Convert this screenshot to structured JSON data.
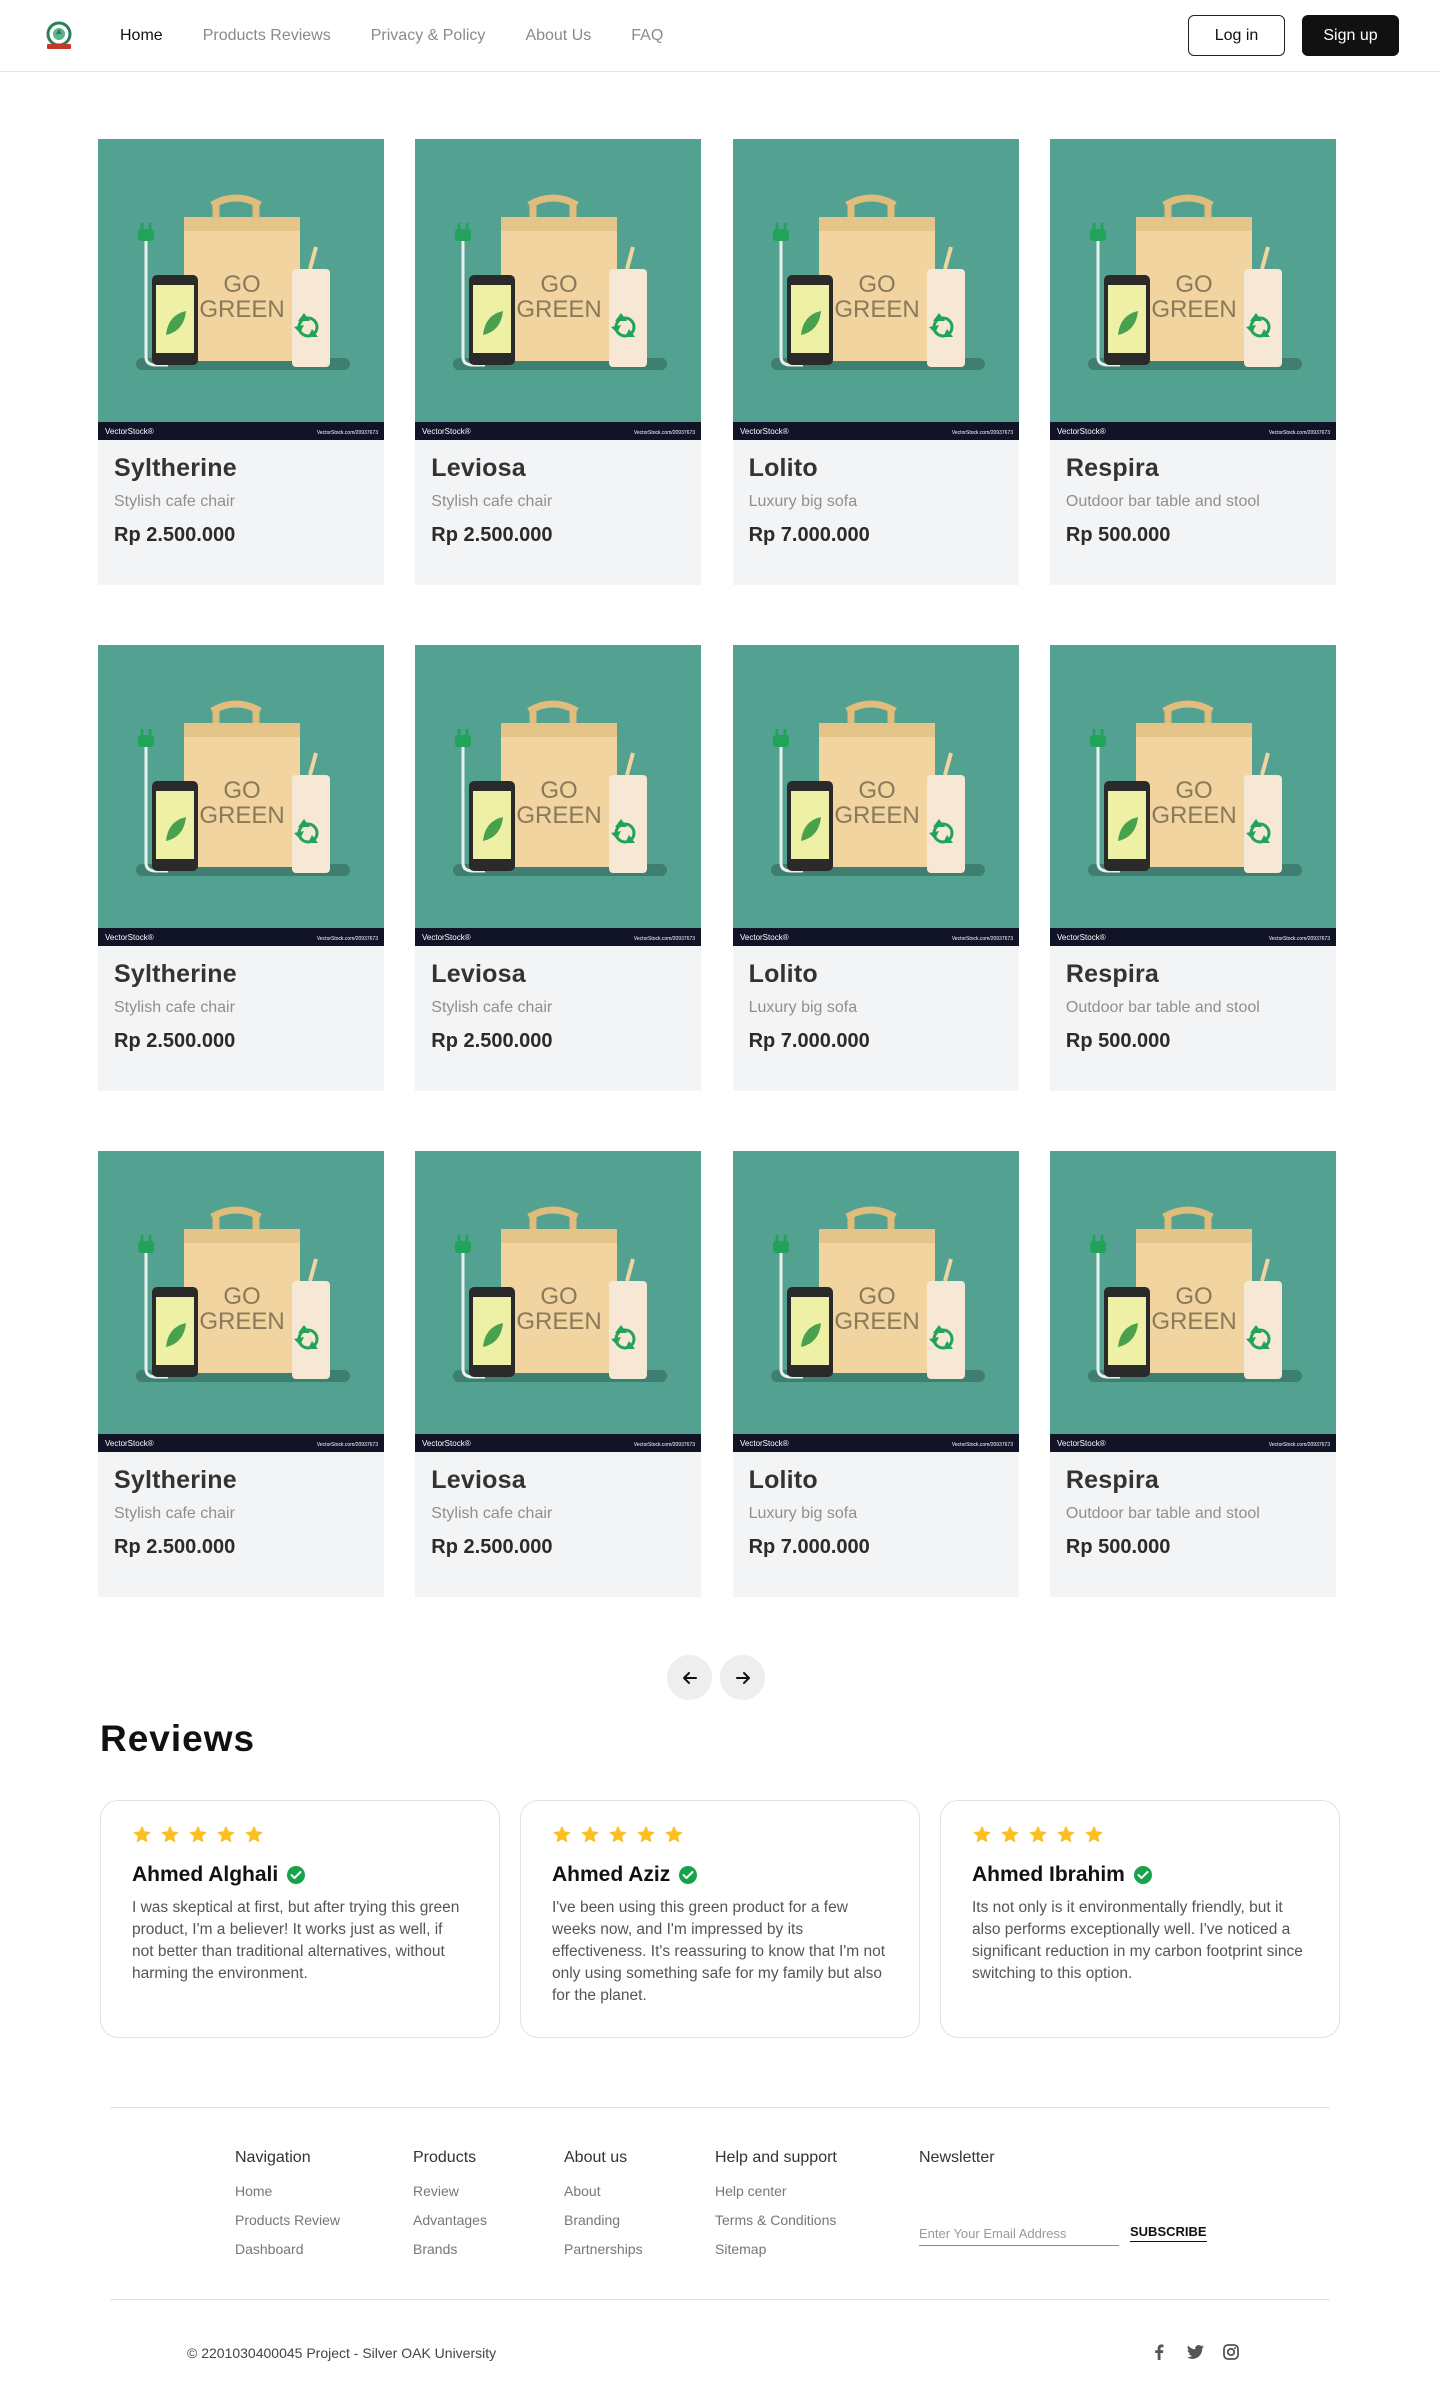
{
  "header": {
    "nav": [
      {
        "label": "Home",
        "active": true
      },
      {
        "label": "Products Reviews",
        "active": false
      },
      {
        "label": "Privacy & Policy",
        "active": false
      },
      {
        "label": "About Us",
        "active": false
      },
      {
        "label": "FAQ",
        "active": false
      }
    ],
    "login_label": "Log in",
    "signup_label": "Sign up"
  },
  "product_image": {
    "text_line1": "GO",
    "text_line2": "GREEN",
    "watermark_left": "VectorStock®",
    "watermark_right": "VectorStock.com/20937673"
  },
  "products": [
    {
      "name": "Syltherine",
      "subtitle": "Stylish cafe chair",
      "price": "Rp 2.500.000"
    },
    {
      "name": "Leviosa",
      "subtitle": "Stylish cafe chair",
      "price": "Rp 2.500.000"
    },
    {
      "name": "Lolito",
      "subtitle": "Luxury big sofa",
      "price": "Rp 7.000.000"
    },
    {
      "name": "Respira",
      "subtitle": "Outdoor bar table and stool",
      "price": "Rp 500.000"
    },
    {
      "name": "Syltherine",
      "subtitle": "Stylish cafe chair",
      "price": "Rp 2.500.000"
    },
    {
      "name": "Leviosa",
      "subtitle": "Stylish cafe chair",
      "price": "Rp 2.500.000"
    },
    {
      "name": "Lolito",
      "subtitle": "Luxury big sofa",
      "price": "Rp 7.000.000"
    },
    {
      "name": "Respira",
      "subtitle": "Outdoor bar table and stool",
      "price": "Rp 500.000"
    },
    {
      "name": "Syltherine",
      "subtitle": "Stylish cafe chair",
      "price": "Rp 2.500.000"
    },
    {
      "name": "Leviosa",
      "subtitle": "Stylish cafe chair",
      "price": "Rp 2.500.000"
    },
    {
      "name": "Lolito",
      "subtitle": "Luxury big sofa",
      "price": "Rp 7.000.000"
    },
    {
      "name": "Respira",
      "subtitle": "Outdoor bar table and stool",
      "price": "Rp 500.000"
    }
  ],
  "pager": {
    "prev_icon": "arrow-left-icon",
    "next_icon": "arrow-right-icon"
  },
  "reviews": {
    "title": "Reviews",
    "items": [
      {
        "name": "Ahmed Alghali",
        "rating": 5,
        "text": "I was skeptical at first, but after trying this green product, I'm a believer! It works just as well, if not better than traditional alternatives, without harming the environment."
      },
      {
        "name": "Ahmed Aziz",
        "rating": 5,
        "text": "I've been using this green product for a few weeks now, and I'm impressed by its effectiveness. It's reassuring to know that I'm not only using something safe for my family but also for the planet."
      },
      {
        "name": "Ahmed Ibrahim",
        "rating": 5,
        "text": "Its not only is it environmentally friendly, but it also performs exceptionally well. I've noticed a significant reduction in my carbon footprint since switching to this option."
      }
    ]
  },
  "footer": {
    "columns": [
      {
        "title": "Navigation",
        "links": [
          "Home",
          "Products Review",
          "Dashboard"
        ]
      },
      {
        "title": "Products",
        "links": [
          "Review",
          "Advantages",
          "Brands"
        ]
      },
      {
        "title": "About us",
        "links": [
          "About",
          "Branding",
          "Partnerships"
        ]
      },
      {
        "title": "Help and support",
        "links": [
          "Help center",
          "Terms & Conditions",
          "Sitemap"
        ]
      }
    ],
    "newsletter": {
      "title": "Newsletter",
      "placeholder": "Enter Your Email Address",
      "button": "SUBSCRIBE"
    },
    "copyright": "© 2201030400045 Project - Silver OAK University",
    "socials": [
      "facebook-icon",
      "twitter-icon",
      "instagram-icon"
    ]
  },
  "colors": {
    "image_bg": "#53a191",
    "bag": "#f1d49f",
    "star": "#fbbf24",
    "verified": "#16a34a",
    "dark": "#111111"
  }
}
